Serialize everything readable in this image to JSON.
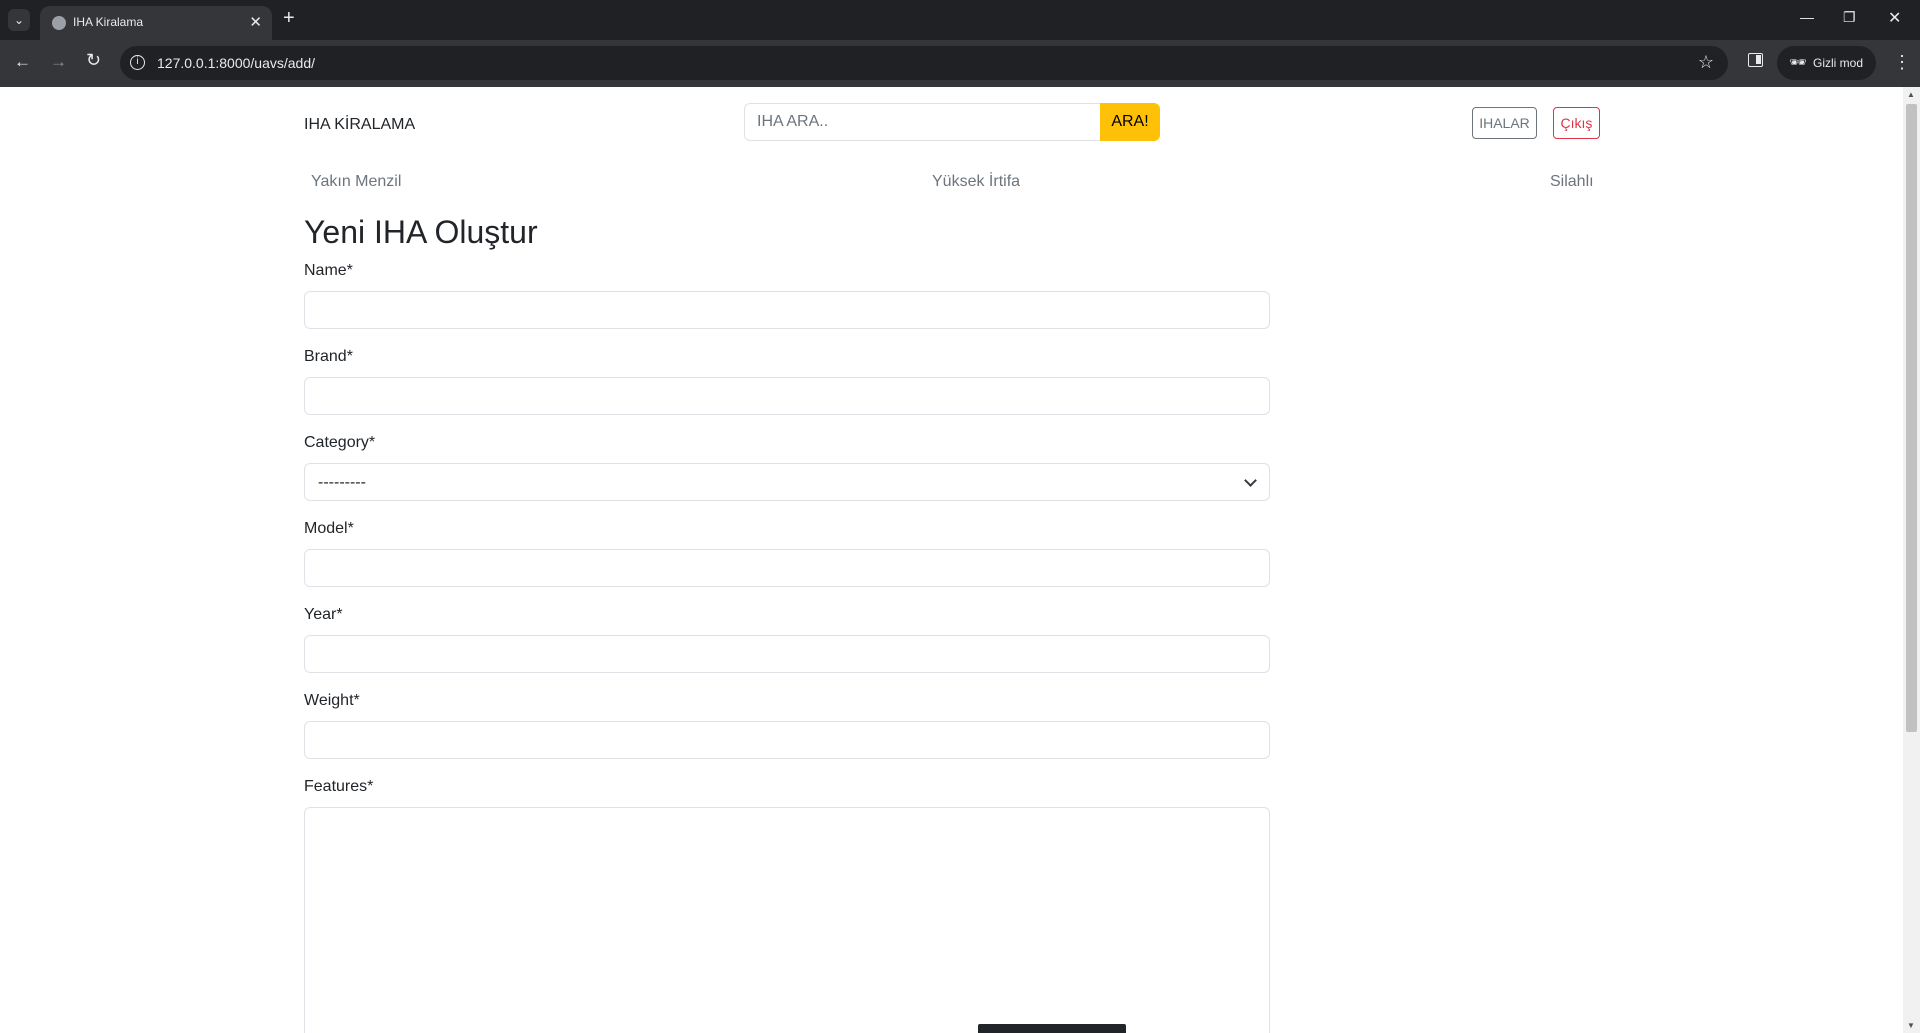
{
  "browser": {
    "tab_title": "IHA Kiralama",
    "url": "127.0.0.1:8000/uavs/add/",
    "incognito_label": "Gizli mod",
    "icons": [
      "tab-search-icon",
      "globe-icon",
      "close-icon",
      "plus-icon",
      "minimize-icon",
      "restore-icon",
      "window-close-icon",
      "back-arrow-icon",
      "forward-arrow-icon",
      "reload-icon",
      "site-info-icon",
      "star-icon",
      "side-panel-icon",
      "incognito-icon",
      "menu-dots-icon"
    ]
  },
  "header": {
    "brand": "IHA KİRALAMA",
    "search_placeholder": "IHA ARA..",
    "search_button": "ARA!",
    "ihalar_button": "IHALAR",
    "logout_button": "Çıkış",
    "colors": {
      "search_button": "#ffc107",
      "logout": "#dc3545",
      "ihalar": "#6c757d"
    }
  },
  "categories": [
    "Yakın Menzil",
    "Yüksek İrtifa",
    "Silahlı"
  ],
  "form": {
    "title": "Yeni IHA Oluştur",
    "fields": {
      "name": {
        "label": "Name*",
        "value": ""
      },
      "brand": {
        "label": "Brand*",
        "value": ""
      },
      "category": {
        "label": "Category*",
        "selected": "---------"
      },
      "model": {
        "label": "Model*",
        "value": ""
      },
      "year": {
        "label": "Year*",
        "value": ""
      },
      "weight": {
        "label": "Weight*",
        "value": ""
      },
      "features": {
        "label": "Features*",
        "value": ""
      }
    }
  }
}
